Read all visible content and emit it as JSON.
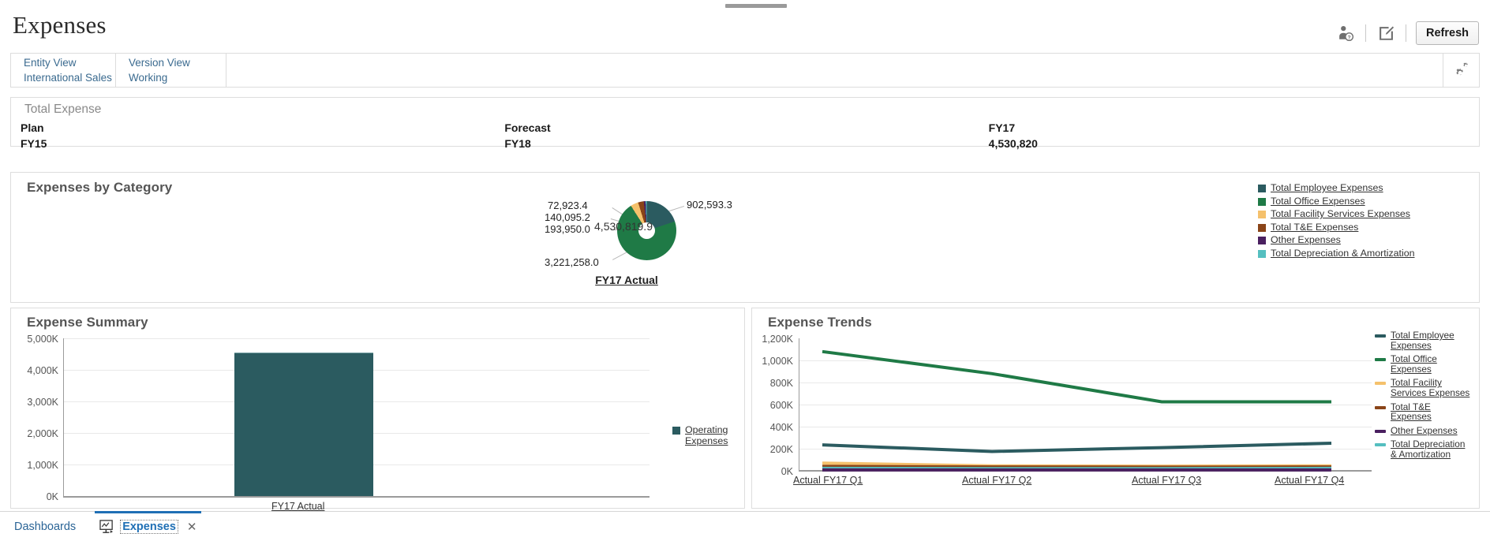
{
  "header": {
    "title": "Expenses",
    "user_icon": "user-help-icon",
    "edit_icon": "edit-square-icon",
    "refresh_label": "Refresh"
  },
  "pov": {
    "settings_icon": "gears-icon",
    "fields": [
      {
        "dimension": "Entity View",
        "member": "International Sales"
      },
      {
        "dimension": "Version View",
        "member": "Working"
      }
    ]
  },
  "total_expense": {
    "title": "Total Expense",
    "columns": [
      {
        "label": "Plan",
        "value": "FY15"
      },
      {
        "label": "Forecast",
        "value": "FY18"
      },
      {
        "label": "FY17",
        "value": "4,530,820"
      }
    ]
  },
  "category_panel": {
    "title": "Expenses by Category"
  },
  "summary_panel": {
    "title": "Expense Summary"
  },
  "trends_panel": {
    "title": "Expense Trends"
  },
  "colors": {
    "employee": "#2b5b60",
    "office": "#1f7a46",
    "facility": "#f5c16c",
    "te": "#8a4418",
    "other": "#4a2060",
    "depreciation": "#55bfc0",
    "accent": "#1f6fb5",
    "link": "#2a6496"
  },
  "taskbar": {
    "dashboards_label": "Dashboards",
    "tab_icon": "dashboard-chart-icon",
    "tab_label": "Expenses",
    "close_icon": "close-icon"
  },
  "chart_data": [
    {
      "type": "pie",
      "title": "FY17 Actual",
      "center_label": "4,530,819.9",
      "labels": [
        "Total Employee Expenses",
        "Total Office Expenses",
        "Total Facility Services Expenses",
        "Total T&E Expenses",
        "Other Expenses",
        "Total Depreciation & Amortization"
      ],
      "values": [
        902593.3,
        3221258.0,
        193950.0,
        140095.2,
        72923.4,
        0.0
      ],
      "data_labels": [
        "902,593.3",
        "3,221,258.0",
        "193,950.0",
        "140,095.2",
        "72,923.4"
      ],
      "colors": [
        "#2b5b60",
        "#1f7a46",
        "#f5c16c",
        "#8a4418",
        "#4a2060",
        "#55bfc0"
      ],
      "legend_position": "right"
    },
    {
      "type": "bar",
      "title": "Expense Summary",
      "categories": [
        "FY17 Actual"
      ],
      "series": [
        {
          "name": "Operating Expenses",
          "values": [
            4530820
          ]
        }
      ],
      "ylim": [
        0,
        5000000
      ],
      "yticks": [
        "0K",
        "1,000K",
        "2,000K",
        "3,000K",
        "4,000K",
        "5,000K"
      ],
      "xlabel": "",
      "ylabel": "",
      "grid": true,
      "legend_position": "right",
      "colors": [
        "#2b5b60"
      ]
    },
    {
      "type": "line",
      "title": "Expense Trends",
      "categories": [
        "Actual FY17 Q1",
        "Actual FY17 Q2",
        "Actual FY17 Q3",
        "Actual FY17 Q4"
      ],
      "series": [
        {
          "name": "Total Employee Expenses",
          "values": [
            235000,
            175000,
            210000,
            250000
          ]
        },
        {
          "name": "Total Office Expenses",
          "values": [
            1080000,
            880000,
            625000,
            625000
          ]
        },
        {
          "name": "Total Facility Services Expenses",
          "values": [
            70000,
            45000,
            42000,
            45000
          ]
        },
        {
          "name": "Total T&E Expenses",
          "values": [
            40000,
            35000,
            33000,
            35000
          ]
        },
        {
          "name": "Other Expenses",
          "values": [
            8000,
            8000,
            8000,
            8000
          ]
        },
        {
          "name": "Total Depreciation & Amortization",
          "values": [
            22000,
            20000,
            20000,
            22000
          ]
        }
      ],
      "ylim": [
        0,
        1200000
      ],
      "yticks": [
        "0K",
        "200K",
        "400K",
        "600K",
        "800K",
        "1,000K",
        "1,200K"
      ],
      "grid": true,
      "legend_position": "right",
      "colors": [
        "#2b5b60",
        "#1f7a46",
        "#f5c16c",
        "#8a4418",
        "#4a2060",
        "#55bfc0"
      ]
    }
  ]
}
